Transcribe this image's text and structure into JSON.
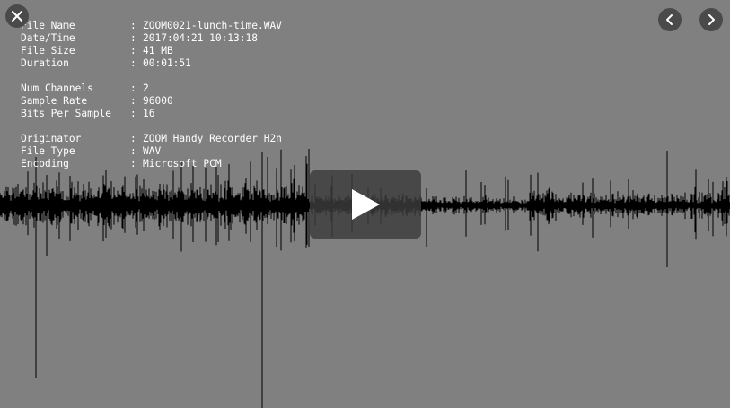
{
  "metadata": {
    "groups": [
      [
        {
          "key": "File Name",
          "sep": ":",
          "value": "ZOOM0021-lunch-time.WAV"
        },
        {
          "key": "Date/Time",
          "sep": ":",
          "value": "2017:04:21 10:13:18"
        },
        {
          "key": "File Size",
          "sep": ":",
          "value": "41 MB"
        },
        {
          "key": "Duration",
          "sep": ":",
          "value": "00:01:51"
        }
      ],
      [
        {
          "key": "Num Channels",
          "sep": ":",
          "value": "2"
        },
        {
          "key": "Sample Rate",
          "sep": ":",
          "value": "96000"
        },
        {
          "key": "Bits Per Sample",
          "sep": ":",
          "value": "16"
        }
      ],
      [
        {
          "key": "Originator",
          "sep": ":",
          "value": "ZOOM Handy Recorder H2n"
        },
        {
          "key": "File Type",
          "sep": ":",
          "value": "WAV"
        },
        {
          "key": "Encoding",
          "sep": ":",
          "value": "Microsoft PCM"
        }
      ]
    ]
  },
  "controls": {
    "close_icon": "close-icon",
    "prev_icon": "chevron-left-icon",
    "next_icon": "chevron-right-icon",
    "play_icon": "play-icon"
  },
  "colors": {
    "background": "#808080",
    "waveform": "#000000",
    "button": "#4a4a4a",
    "icon": "#ffffff",
    "text": "#ffffff"
  }
}
